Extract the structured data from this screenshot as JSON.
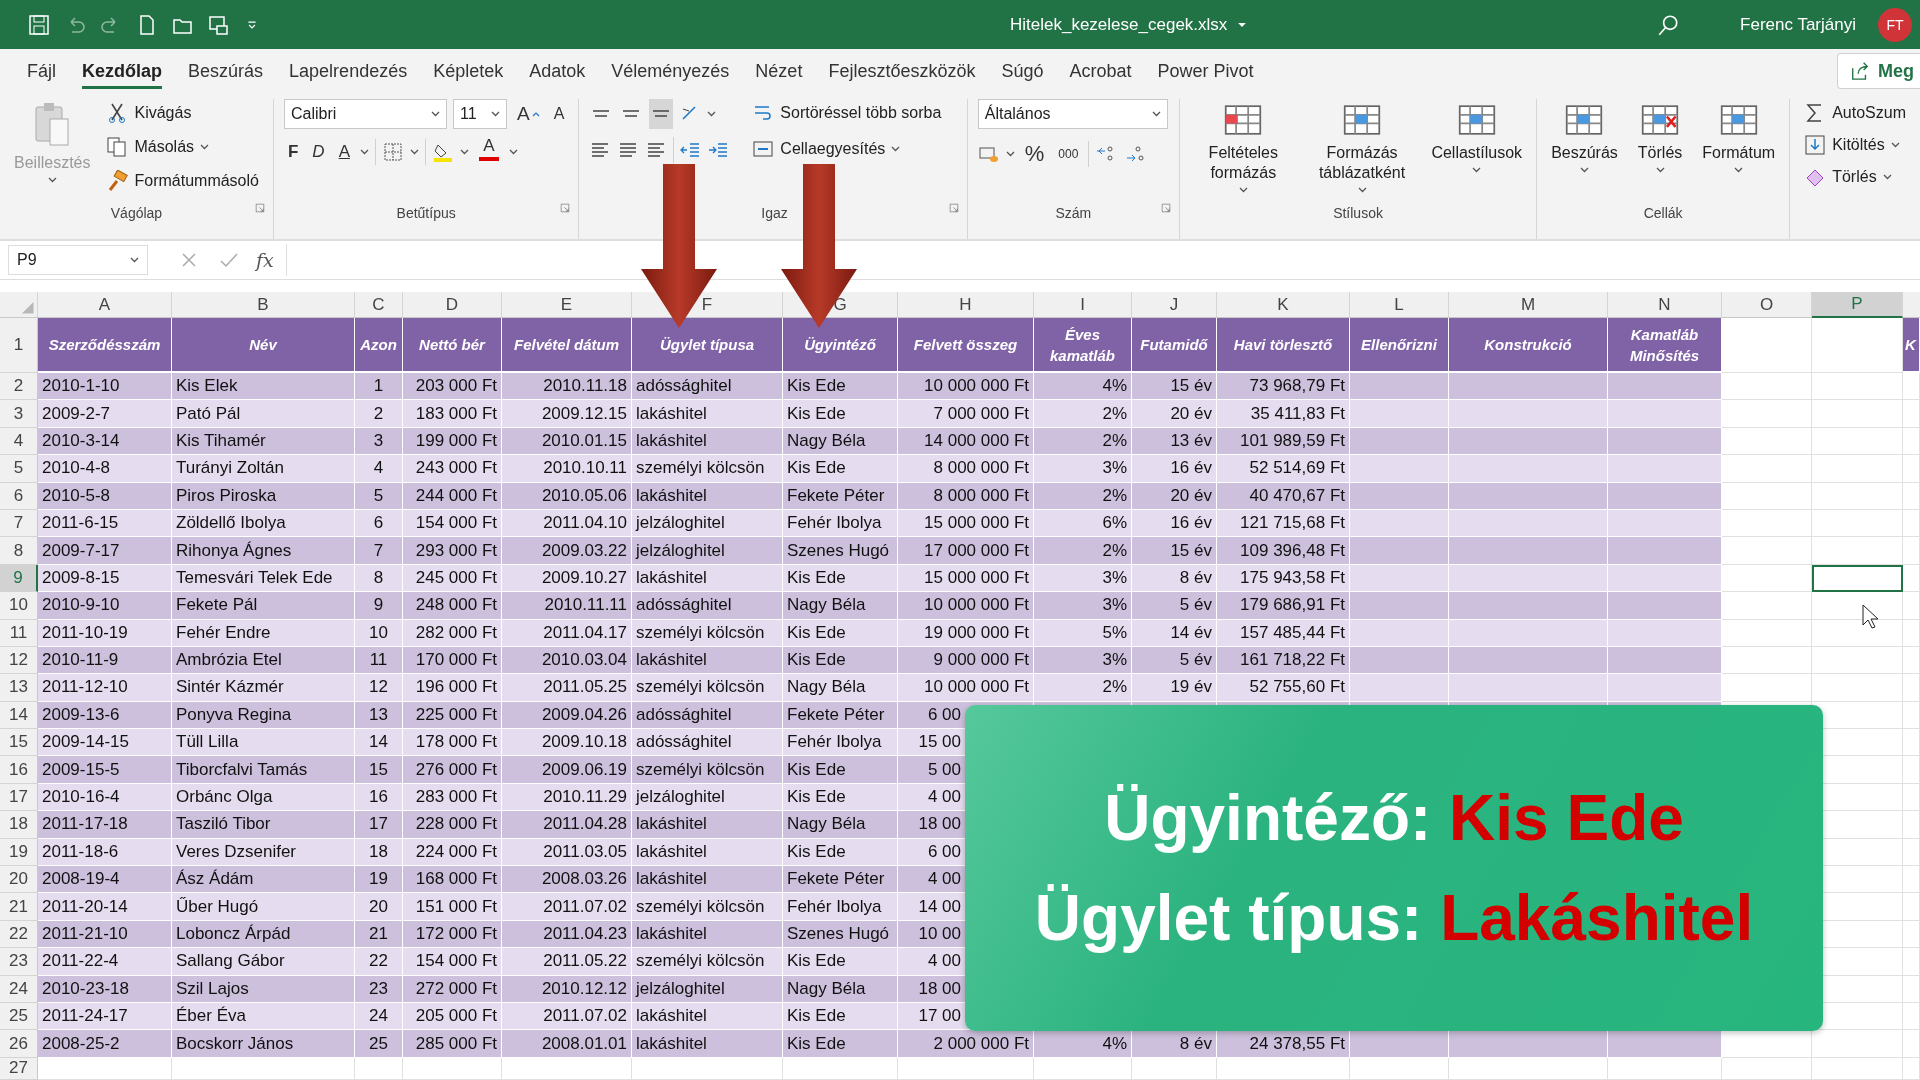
{
  "window": {
    "title": "Hitelek_kezelese_cegek.xlsx",
    "user": "Ferenc Tarjányi",
    "avatar": "FT"
  },
  "tabs": [
    {
      "label": "Fájl",
      "selected": false
    },
    {
      "label": "Kezdőlap",
      "selected": true
    },
    {
      "label": "Beszúrás",
      "selected": false
    },
    {
      "label": "Lapelrendezés",
      "selected": false
    },
    {
      "label": "Képletek",
      "selected": false
    },
    {
      "label": "Adatok",
      "selected": false
    },
    {
      "label": "Véleményezés",
      "selected": false
    },
    {
      "label": "Nézet",
      "selected": false
    },
    {
      "label": "Fejlesztőeszközök",
      "selected": false
    },
    {
      "label": "Súgó",
      "selected": false
    },
    {
      "label": "Acrobat",
      "selected": false
    },
    {
      "label": "Power Pivot",
      "selected": false
    }
  ],
  "share_button": "Meg",
  "ribbon": [
    {
      "kind": "clipboard",
      "label": "Vágólap",
      "paste": {
        "label": "Beillesztés",
        "disabled": true
      },
      "actions": [
        "Kivágás",
        "Másolás",
        "Formátummásoló"
      ]
    },
    {
      "kind": "font",
      "label": "Betűtípus",
      "font_name": "Calibri",
      "font_size": "11",
      "grow": "A",
      "shrink": "A",
      "bold": "F",
      "italic": "D",
      "underline": "A",
      "font_color": "A"
    },
    {
      "kind": "alignment",
      "label": "Igaz",
      "valign_buttons": [
        {
          "selected": false
        },
        {
          "selected": false
        },
        {
          "selected": true
        }
      ],
      "wrap": "Sortöréssel több sorba",
      "merge": "Cellaegyesítés"
    },
    {
      "kind": "number",
      "label": "Szám",
      "format": "Általános",
      "percent": "%",
      "thousands": "000"
    },
    {
      "kind": "large",
      "label": "Stílusok",
      "buttons": [
        "Feltételes formázás",
        "Formázás táblázatként",
        "Cellastílusok"
      ]
    },
    {
      "kind": "large",
      "label": "Cellák",
      "buttons": [
        "Beszúrás",
        "Törlés",
        "Formátum"
      ]
    },
    {
      "kind": "editing",
      "actions": [
        "AutoSzum",
        "Kitöltés",
        "Törlés"
      ]
    }
  ],
  "formula_bar": {
    "name_box": "P9",
    "function_label": "fx"
  },
  "sheet": {
    "columns": [
      {
        "letter": "A",
        "selected": false
      },
      {
        "letter": "B",
        "selected": false
      },
      {
        "letter": "C",
        "selected": false
      },
      {
        "letter": "D",
        "selected": false
      },
      {
        "letter": "E",
        "selected": false
      },
      {
        "letter": "F",
        "selected": false
      },
      {
        "letter": "G",
        "selected": false
      },
      {
        "letter": "H",
        "selected": false
      },
      {
        "letter": "I",
        "selected": false
      },
      {
        "letter": "J",
        "selected": false
      },
      {
        "letter": "K",
        "selected": false
      },
      {
        "letter": "L",
        "selected": false
      },
      {
        "letter": "M",
        "selected": false
      },
      {
        "letter": "N",
        "selected": false
      },
      {
        "letter": "O",
        "selected": false
      },
      {
        "letter": "P",
        "selected": true
      }
    ],
    "header_cells": [
      "Szerződésszám",
      "Név",
      "Azon",
      "Nettó bér",
      "Felvétel dátum",
      "Ügylet típusa",
      "Ügyintéző",
      "Felvett összeg",
      "Éves kamatláb",
      "Futamidő",
      "Havi törlesztő",
      "Ellenőrizni",
      "Konstrukció",
      "Kamatláb Minősítés"
    ],
    "column_q_header": "K",
    "header_row_number": "1",
    "rows": [
      {
        "number": "2",
        "selected": false,
        "cells": [
          "2010-1-10",
          "Kis Elek",
          "1",
          "203 000 Ft",
          "2010.11.18",
          "adóssághitel",
          "Kis Ede",
          "10 000 000 Ft",
          "4%",
          "15 év",
          "73 968,79 Ft"
        ]
      },
      {
        "number": "3",
        "selected": false,
        "cells": [
          "2009-2-7",
          "Pató Pál",
          "2",
          "183 000 Ft",
          "2009.12.15",
          "lakáshitel",
          "Kis Ede",
          "7 000 000 Ft",
          "2%",
          "20 év",
          "35 411,83 Ft"
        ]
      },
      {
        "number": "4",
        "selected": false,
        "cells": [
          "2010-3-14",
          "Kis Tihamér",
          "3",
          "199 000 Ft",
          "2010.01.15",
          "lakáshitel",
          "Nagy Béla",
          "14 000 000 Ft",
          "2%",
          "13 év",
          "101 989,59 Ft"
        ]
      },
      {
        "number": "5",
        "selected": false,
        "cells": [
          "2010-4-8",
          "Turányi Zoltán",
          "4",
          "243 000 Ft",
          "2010.10.11",
          "személyi kölcsön",
          "Kis Ede",
          "8 000 000 Ft",
          "3%",
          "16 év",
          "52 514,69 Ft"
        ]
      },
      {
        "number": "6",
        "selected": false,
        "cells": [
          "2010-5-8",
          "Piros Piroska",
          "5",
          "244 000 Ft",
          "2010.05.06",
          "lakáshitel",
          "Fekete Péter",
          "8 000 000 Ft",
          "2%",
          "20 év",
          "40 470,67 Ft"
        ]
      },
      {
        "number": "7",
        "selected": false,
        "cells": [
          "2011-6-15",
          "Zöldellő Ibolya",
          "6",
          "154 000 Ft",
          "2011.04.10",
          "jelzáloghitel",
          "Fehér Ibolya",
          "15 000 000 Ft",
          "6%",
          "16 év",
          "121 715,68 Ft"
        ]
      },
      {
        "number": "8",
        "selected": false,
        "cells": [
          "2009-7-17",
          "Rihonya Ágnes",
          "7",
          "293 000 Ft",
          "2009.03.22",
          "jelzáloghitel",
          "Szenes Hugó",
          "17 000 000 Ft",
          "2%",
          "15 év",
          "109 396,48 Ft"
        ]
      },
      {
        "number": "9",
        "selected": true,
        "cells": [
          "2009-8-15",
          "Temesvári Telek Ede",
          "8",
          "245 000 Ft",
          "2009.10.27",
          "lakáshitel",
          "Kis Ede",
          "15 000 000 Ft",
          "3%",
          "8 év",
          "175 943,58 Ft"
        ]
      },
      {
        "number": "10",
        "selected": false,
        "cells": [
          "2010-9-10",
          "Fekete Pál",
          "9",
          "248 000 Ft",
          "2010.11.11",
          "adóssághitel",
          "Nagy Béla",
          "10 000 000 Ft",
          "3%",
          "5 év",
          "179 686,91 Ft"
        ]
      },
      {
        "number": "11",
        "selected": false,
        "cells": [
          "2011-10-19",
          "Fehér Endre",
          "10",
          "282 000 Ft",
          "2011.04.17",
          "személyi kölcsön",
          "Kis Ede",
          "19 000 000 Ft",
          "5%",
          "14 év",
          "157 485,44 Ft"
        ]
      },
      {
        "number": "12",
        "selected": false,
        "cells": [
          "2010-11-9",
          "Ambrózia Etel",
          "11",
          "170 000 Ft",
          "2010.03.04",
          "lakáshitel",
          "Kis Ede",
          "9 000 000 Ft",
          "3%",
          "5 év",
          "161 718,22 Ft"
        ]
      },
      {
        "number": "13",
        "selected": false,
        "cells": [
          "2011-12-10",
          "Sintér Kázmér",
          "12",
          "196 000 Ft",
          "2011.05.25",
          "személyi kölcsön",
          "Nagy Béla",
          "10 000 000 Ft",
          "2%",
          "19 év",
          "52 755,60 Ft"
        ]
      },
      {
        "number": "14",
        "selected": false,
        "cells": [
          "2009-13-6",
          "Ponyva Regina",
          "13",
          "225 000 Ft",
          "2009.04.26",
          "adóssághitel",
          "Fekete Péter",
          "6 00"
        ]
      },
      {
        "number": "15",
        "selected": false,
        "cells": [
          "2009-14-15",
          "Tüll Lilla",
          "14",
          "178 000 Ft",
          "2009.10.18",
          "adóssághitel",
          "Fehér Ibolya",
          "15 00"
        ]
      },
      {
        "number": "16",
        "selected": false,
        "cells": [
          "2009-15-5",
          "Tiborcfalvi Tamás",
          "15",
          "276 000 Ft",
          "2009.06.19",
          "személyi kölcsön",
          "Kis Ede",
          "5 00"
        ]
      },
      {
        "number": "17",
        "selected": false,
        "cells": [
          "2010-16-4",
          "Orbánc Olga",
          "16",
          "283 000 Ft",
          "2010.11.29",
          "jelzáloghitel",
          "Kis Ede",
          "4 00"
        ]
      },
      {
        "number": "18",
        "selected": false,
        "cells": [
          "2011-17-18",
          "Tasziló Tibor",
          "17",
          "228 000 Ft",
          "2011.04.28",
          "lakáshitel",
          "Nagy Béla",
          "18 00"
        ]
      },
      {
        "number": "19",
        "selected": false,
        "cells": [
          "2011-18-6",
          "Veres Dzsenifer",
          "18",
          "224 000 Ft",
          "2011.03.05",
          "lakáshitel",
          "Kis Ede",
          "6 00"
        ]
      },
      {
        "number": "20",
        "selected": false,
        "cells": [
          "2008-19-4",
          "Ász Ádám",
          "19",
          "168 000 Ft",
          "2008.03.26",
          "lakáshitel",
          "Fekete Péter",
          "4 00"
        ]
      },
      {
        "number": "21",
        "selected": false,
        "cells": [
          "2011-20-14",
          "Űber Hugó",
          "20",
          "151 000 Ft",
          "2011.07.02",
          "személyi kölcsön",
          "Fehér Ibolya",
          "14 00"
        ]
      },
      {
        "number": "22",
        "selected": false,
        "cells": [
          "2011-21-10",
          "Loboncz Árpád",
          "21",
          "172 000 Ft",
          "2011.04.23",
          "lakáshitel",
          "Szenes Hugó",
          "10 00"
        ]
      },
      {
        "number": "23",
        "selected": false,
        "cells": [
          "2011-22-4",
          "Sallang Gábor",
          "22",
          "154 000 Ft",
          "2011.05.22",
          "személyi kölcsön",
          "Kis Ede",
          "4 00"
        ]
      },
      {
        "number": "24",
        "selected": false,
        "cells": [
          "2010-23-18",
          "Szil Lajos",
          "23",
          "272 000 Ft",
          "2010.12.12",
          "jelzáloghitel",
          "Nagy Béla",
          "18 00"
        ]
      },
      {
        "number": "25",
        "selected": false,
        "cells": [
          "2011-24-17",
          "Éber Éva",
          "24",
          "205 000 Ft",
          "2011.07.02",
          "lakáshitel",
          "Kis Ede",
          "17 00"
        ]
      },
      {
        "number": "26",
        "selected": false,
        "cells": [
          "2008-25-2",
          "Bocskorr János",
          "25",
          "285 000 Ft",
          "2008.01.01",
          "lakáshitel",
          "Kis Ede",
          "2 000 000 Ft",
          "4%",
          "8 év",
          "24 378,55 Ft"
        ]
      },
      {
        "number": "27",
        "selected": false,
        "cells": []
      }
    ]
  },
  "callout": {
    "lines": [
      {
        "label": "Ügyintéző:",
        "value": "Kis Ede"
      },
      {
        "label": "Ügylet típus:",
        "value": "Lakáshitel"
      }
    ]
  }
}
